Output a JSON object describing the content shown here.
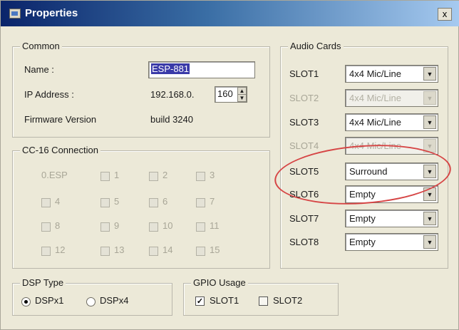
{
  "window": {
    "title": "Properties",
    "close_symbol": "x"
  },
  "common": {
    "legend": "Common",
    "name_label": "Name :",
    "name_value": "ESP-881",
    "ip_label": "IP Address :",
    "ip_prefix": "192.168.0.",
    "ip_last": "160",
    "firmware_label": "Firmware Version",
    "firmware_value": "build  3240"
  },
  "cc16": {
    "legend": "CC-16 Connection",
    "items": [
      {
        "label": "0.ESP"
      },
      {
        "label": "1"
      },
      {
        "label": "2"
      },
      {
        "label": "3"
      },
      {
        "label": "4"
      },
      {
        "label": "5"
      },
      {
        "label": "6"
      },
      {
        "label": "7"
      },
      {
        "label": "8"
      },
      {
        "label": "9"
      },
      {
        "label": "10"
      },
      {
        "label": "11"
      },
      {
        "label": "12"
      },
      {
        "label": "13"
      },
      {
        "label": "14"
      },
      {
        "label": "15"
      }
    ]
  },
  "dsp": {
    "legend": "DSP Type",
    "options": [
      {
        "label": "DSPx1",
        "selected": true
      },
      {
        "label": "DSPx4",
        "selected": false
      }
    ]
  },
  "gpio": {
    "legend": "GPIO Usage",
    "options": [
      {
        "label": "SLOT1",
        "checked": true
      },
      {
        "label": "SLOT2",
        "checked": false
      }
    ]
  },
  "audio": {
    "legend": "Audio Cards",
    "slots": [
      {
        "label": "SLOT1",
        "value": "4x4 Mic/Line",
        "enabled": true
      },
      {
        "label": "SLOT2",
        "value": "4x4 Mic/Line",
        "enabled": false
      },
      {
        "label": "SLOT3",
        "value": "4x4 Mic/Line",
        "enabled": true
      },
      {
        "label": "SLOT4",
        "value": "4x4 Mic/Line",
        "enabled": false
      },
      {
        "label": "SLOT5",
        "value": "Surround",
        "enabled": true
      },
      {
        "label": "SLOT6",
        "value": "Empty",
        "enabled": true
      },
      {
        "label": "SLOT7",
        "value": "Empty",
        "enabled": true
      },
      {
        "label": "SLOT8",
        "value": "Empty",
        "enabled": true
      }
    ]
  },
  "annotation": {
    "highlight": "SLOT5",
    "color": "#d64545"
  },
  "colors": {
    "title_start": "#0a246a",
    "title_end": "#a6caf0",
    "face": "#ece9d8",
    "selection": "#3a3aa8"
  }
}
